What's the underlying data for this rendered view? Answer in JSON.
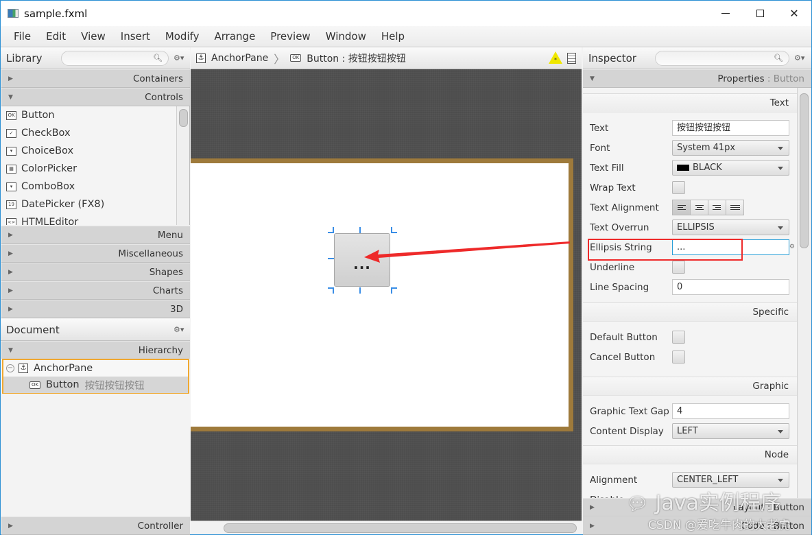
{
  "window": {
    "title": "sample.fxml",
    "controls": {
      "minimize": "minimize",
      "maximize": "maximize",
      "close": "✕"
    }
  },
  "menu": [
    "File",
    "Edit",
    "View",
    "Insert",
    "Modify",
    "Arrange",
    "Preview",
    "Window",
    "Help"
  ],
  "library": {
    "title": "Library",
    "search_placeholder": "",
    "sections_top": [
      {
        "label": "Containers",
        "expanded": false
      },
      {
        "label": "Controls",
        "expanded": true
      }
    ],
    "controls": [
      {
        "label": "Button",
        "icon": "ok-button-icon",
        "glyph": "OK"
      },
      {
        "label": "CheckBox",
        "icon": "checkbox-icon",
        "glyph": "✓"
      },
      {
        "label": "ChoiceBox",
        "icon": "choicebox-icon",
        "glyph": "▾"
      },
      {
        "label": "ColorPicker",
        "icon": "colorpicker-icon",
        "glyph": "▦"
      },
      {
        "label": "ComboBox",
        "icon": "combobox-icon",
        "glyph": "▾"
      },
      {
        "label": "DatePicker  (FX8)",
        "icon": "datepicker-icon",
        "glyph": "19"
      },
      {
        "label": "HTMLEditor",
        "icon": "htmleditor-icon",
        "glyph": "<>"
      }
    ],
    "sections_bottom": [
      "Menu",
      "Miscellaneous",
      "Shapes",
      "Charts",
      "3D"
    ]
  },
  "document": {
    "title": "Document",
    "hierarchy_label": "Hierarchy",
    "tree": [
      {
        "label": "AnchorPane",
        "extra": ""
      },
      {
        "label": "Button",
        "extra": "按钮按钮按钮"
      }
    ],
    "controller_label": "Controller"
  },
  "breadcrumb": {
    "items": [
      {
        "label": "AnchorPane"
      },
      {
        "label": "Button : 按钮按钮按钮"
      }
    ]
  },
  "canvas": {
    "button_text": "..."
  },
  "inspector": {
    "title": "Inspector",
    "search_placeholder": "",
    "properties_label": "Properties",
    "properties_target": "Button",
    "groups": {
      "text": {
        "title": "Text",
        "text_label": "Text",
        "text_value": "按钮按钮按钮",
        "font_label": "Font",
        "font_value": "System 41px",
        "fill_label": "Text Fill",
        "fill_value": "BLACK",
        "fill_color": "#000000",
        "wrap_label": "Wrap Text",
        "align_label": "Text Alignment",
        "align_selected": "left",
        "overrun_label": "Text Overrun",
        "overrun_value": "ELLIPSIS",
        "ellipsis_label": "Ellipsis String",
        "ellipsis_value": "...",
        "underline_label": "Underline",
        "spacing_label": "Line Spacing",
        "spacing_value": "0"
      },
      "specific": {
        "title": "Specific",
        "default_label": "Default Button",
        "cancel_label": "Cancel Button"
      },
      "graphic": {
        "title": "Graphic",
        "gap_label": "Graphic Text Gap",
        "gap_value": "4",
        "display_label": "Content Display",
        "display_value": "LEFT"
      },
      "node": {
        "title": "Node",
        "alignment_label": "Alignment",
        "alignment_value": "CENTER_LEFT",
        "partial_label": "Disable"
      }
    },
    "layout_label": "Layout : Button",
    "code_label": "Code : Button"
  },
  "watermarks": {
    "wechat": "Java实例程序",
    "csdn": "CSDN @爱吃牛肉的大老虎"
  },
  "colors": {
    "selection_outline": "#f0a830",
    "stage_border": "#9e7a3b",
    "handle_blue": "#3a8ee6",
    "annotation_red": "#ee2a2a",
    "focus_blue": "#2a9fd8"
  }
}
